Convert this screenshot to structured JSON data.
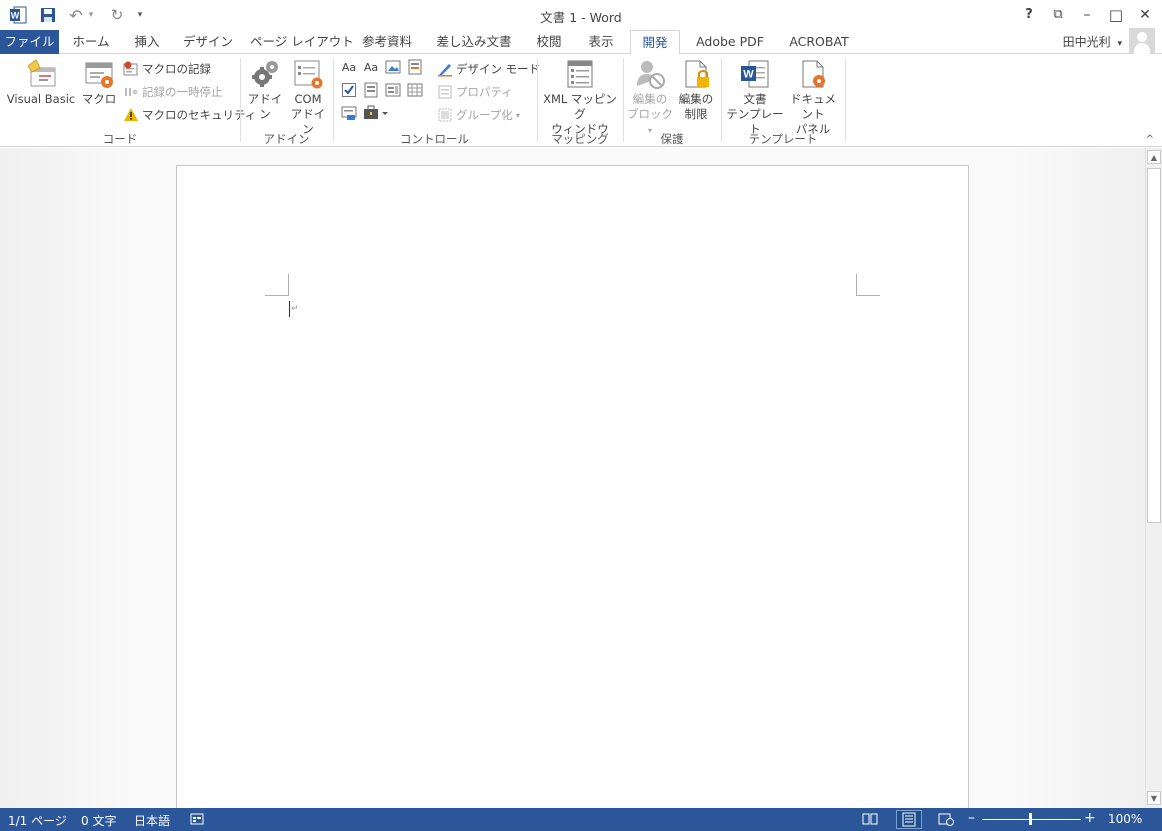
{
  "window": {
    "title": "文書 1 - Word",
    "help": "?",
    "restore_ribbon": "⧉",
    "minimize": "–",
    "maximize": "□",
    "close": "✕"
  },
  "qat": {
    "app_icon": "W",
    "save_icon": "save-icon",
    "undo": "↶",
    "redo": "↻",
    "dropdown": "▾"
  },
  "tabs": [
    "ファイル",
    "ホーム",
    "挿入",
    "デザイン",
    "ページ レイアウト",
    "参考資料",
    "差し込み文書",
    "校閲",
    "表示",
    "開発",
    "Adobe  PDF",
    "ACROBAT"
  ],
  "active_tab": "開発",
  "user": {
    "name": "田中光利",
    "caret": "▾"
  },
  "ribbon": {
    "code": {
      "label": "コード",
      "visual_basic": "Visual Basic",
      "macro": "マクロ",
      "record_macro": "マクロの記録",
      "pause_recording": "記録の一時停止",
      "macro_security": "マクロのセキュリティ"
    },
    "addins": {
      "label": "アドイン",
      "addin": "アドイン",
      "com_addin_line1": "COM",
      "com_addin_line2": "アドイン"
    },
    "controls": {
      "label": "コントロール",
      "design_mode": "デザイン モード",
      "properties": "プロパティ",
      "group": "グループ化",
      "aa1": "Aa",
      "aa2": "Aa"
    },
    "mapping": {
      "label": "マッピング",
      "xml_line1": "XML マッピング",
      "xml_line2": "ウィンドウ"
    },
    "protect": {
      "label": "保護",
      "block_line1": "編集の",
      "block_line2": "ブロック",
      "restrict_line1": "編集の",
      "restrict_line2": "制限"
    },
    "templates": {
      "label": "テンプレート",
      "doc_tmpl_line1": "文書",
      "doc_tmpl_line2": "テンプレート",
      "doc_panel_line1": "ドキュメント",
      "doc_panel_line2": "パネル"
    },
    "collapse": "^"
  },
  "document": {
    "paragraph_mark": "↵"
  },
  "scrollbar": {
    "up": "▲",
    "down": "▼"
  },
  "status": {
    "page": "1/1 ページ",
    "words": "0 文字",
    "language": "日本語",
    "zoom_minus": "–",
    "zoom_plus": "+",
    "zoom": "100%"
  },
  "colors": {
    "accent": "#2b579a",
    "macro_red": "#d24726",
    "orange": "#e8742a"
  }
}
